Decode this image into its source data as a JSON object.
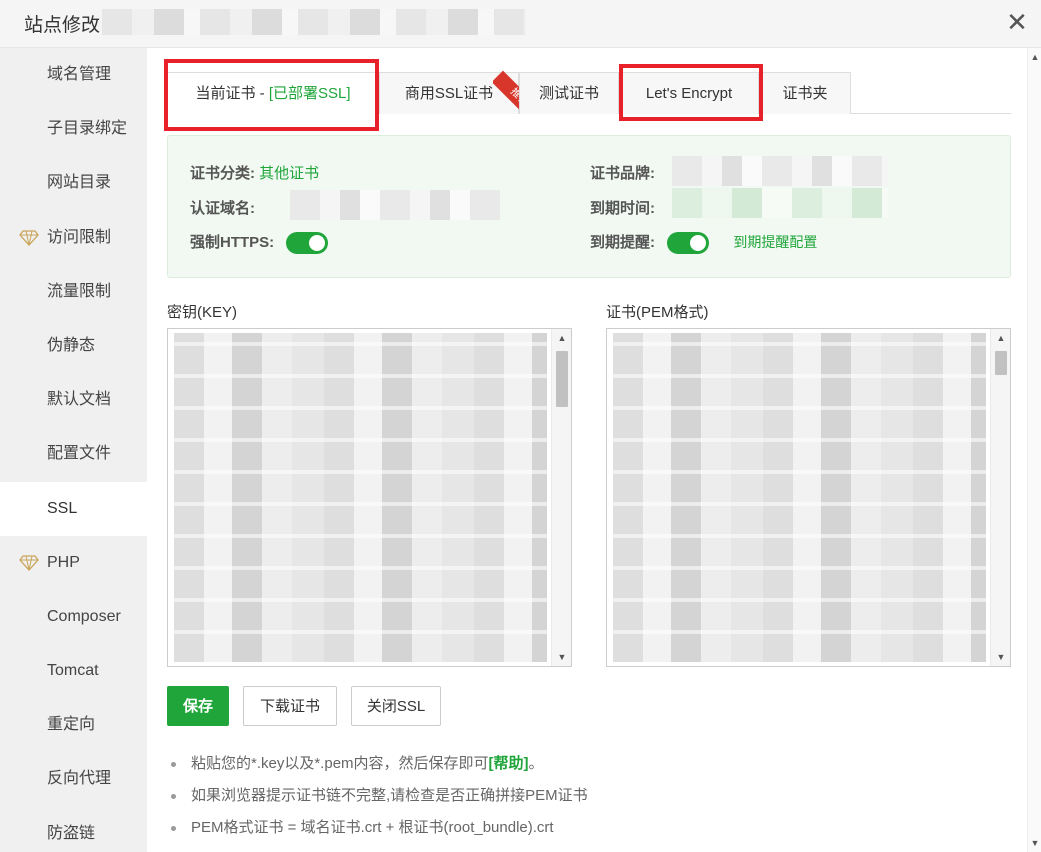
{
  "title": "站点修改",
  "sidebar": {
    "items": [
      {
        "label": "域名管理"
      },
      {
        "label": "子目录绑定"
      },
      {
        "label": "网站目录"
      },
      {
        "label": "访问限制",
        "icon": "diamond-icon"
      },
      {
        "label": "流量限制"
      },
      {
        "label": "伪静态"
      },
      {
        "label": "默认文档"
      },
      {
        "label": "配置文件"
      },
      {
        "label": "SSL",
        "active": true
      },
      {
        "label": "PHP",
        "icon": "diamond-icon"
      },
      {
        "label": "Composer"
      },
      {
        "label": "Tomcat"
      },
      {
        "label": "重定向"
      },
      {
        "label": "反向代理"
      },
      {
        "label": "防盗链"
      }
    ]
  },
  "tabs": {
    "current_prefix": "当前证书 - ",
    "current_status": "[已部署SSL]",
    "commercial": "商用SSL证书",
    "badge": "推荐",
    "test": "测试证书",
    "letsencrypt": "Let's Encrypt",
    "folder": "证书夹"
  },
  "info": {
    "category_label": "证书分类:",
    "category_value": "其他证书",
    "brand_label": "证书品牌:",
    "domain_label": "认证域名:",
    "expire_label": "到期时间:",
    "force_https_label": "强制HTTPS:",
    "reminder_label": "到期提醒:",
    "reminder_config": "到期提醒配置"
  },
  "key_label": "密钥(KEY)",
  "cert_label": "证书(PEM格式)",
  "buttons": {
    "save": "保存",
    "download": "下载证书",
    "close_ssl": "关闭SSL"
  },
  "tips": {
    "t1_prefix": "粘贴您的*.key以及*.pem内容，然后保存即可",
    "t1_help": "[帮助]",
    "t1_suffix": "。",
    "t2": "如果浏览器提示证书链不完整,请检查是否正确拼接PEM证书",
    "t3": "PEM格式证书 = 域名证书.crt + 根证书(root_bundle).crt"
  },
  "colors": {
    "accent": "#20a53a",
    "highlight": "#e8202a",
    "badge": "#d9362b"
  }
}
